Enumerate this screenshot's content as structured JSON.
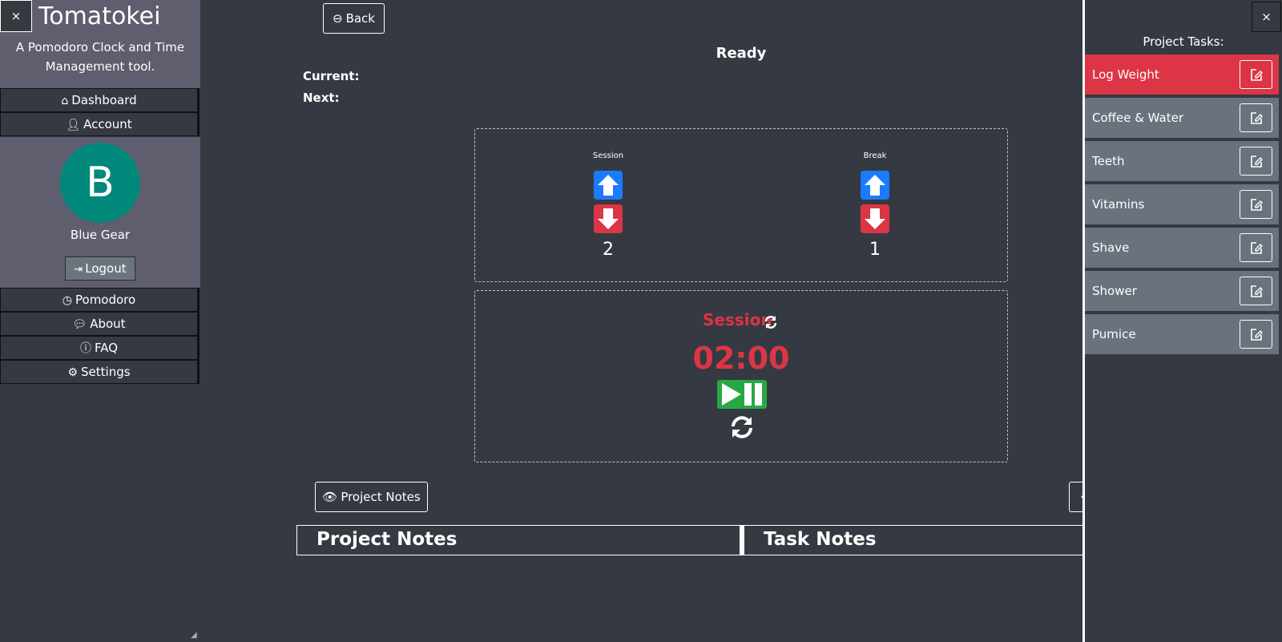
{
  "app": {
    "title": "Tomatokei",
    "subtitle": "A Pomodoro Clock and Time Management tool.",
    "close_symbol": "×"
  },
  "nav": {
    "dashboard": "Dashboard",
    "account": "Account",
    "pomodoro": "Pomodoro",
    "about": "About",
    "faq": "FAQ",
    "settings": "Settings"
  },
  "user": {
    "avatar_letter": "B",
    "name": "Blue Gear",
    "logout_label": "Logout",
    "avatar_color": "#00897b"
  },
  "main": {
    "back_label": "Back",
    "status": "Ready",
    "current_label": "Current:",
    "next_label": "Next:",
    "session_control": {
      "label": "Session",
      "count": "2"
    },
    "break_control": {
      "label": "Break",
      "count": "1"
    },
    "timer": {
      "mode_label": "Session",
      "time": "02:00"
    },
    "project_notes_button": "Project Notes",
    "tabs": {
      "project_notes": "Project Notes",
      "task_notes": "Task Notes"
    }
  },
  "right_sidebar": {
    "title": "Project Tasks:",
    "tasks": [
      {
        "name": "Log Weight",
        "active": true
      },
      {
        "name": "Coffee & Water",
        "active": false
      },
      {
        "name": "Teeth",
        "active": false
      },
      {
        "name": "Vitamins",
        "active": false
      },
      {
        "name": "Shave",
        "active": false
      },
      {
        "name": "Shower",
        "active": false
      },
      {
        "name": "Pumice",
        "active": false
      }
    ]
  },
  "colors": {
    "background": "#353a42",
    "panel": "#5f5e6e",
    "accent_red": "#dc3545",
    "accent_blue": "#1b7bff",
    "accent_green": "#28a745",
    "task_row": "#6a727d"
  },
  "icons": [
    "home-icon",
    "user-icon",
    "logout-icon",
    "clock-icon",
    "comment-icon",
    "question-icon",
    "gears-icon",
    "back-circle-icon",
    "arrow-up-icon",
    "arrow-down-icon",
    "swap-icon",
    "play-pause-icon",
    "reset-icon",
    "eye-icon",
    "edit-icon",
    "close-icon"
  ]
}
